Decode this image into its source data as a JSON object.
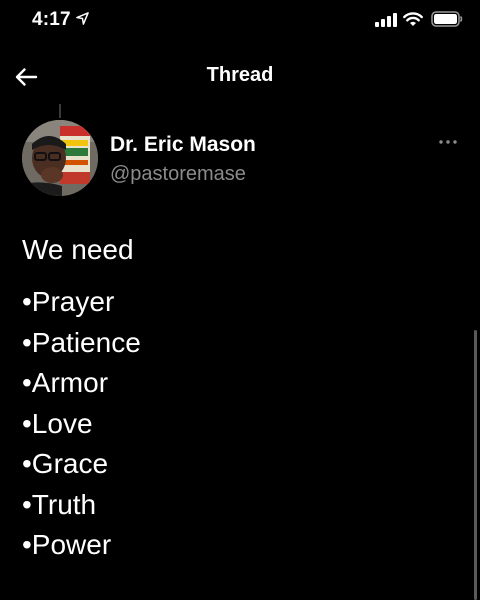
{
  "status_bar": {
    "time": "4:17",
    "icons": [
      "location-arrow-icon",
      "cellular-signal-icon",
      "wifi-icon",
      "battery-icon"
    ]
  },
  "header": {
    "title": "Thread",
    "back_icon": "back-arrow-icon"
  },
  "tweet": {
    "author_name": "Dr. Eric Mason",
    "author_handle": "@pastoremase",
    "intro": "We need",
    "items": [
      "•Prayer",
      "•Patience",
      "•Armor",
      "•Love",
      "•Grace",
      "•Truth",
      "•Power"
    ],
    "more_icon": "more-options-icon"
  },
  "colors": {
    "background": "#000000",
    "primary_text": "#ffffff",
    "secondary_text": "#8b8b8b"
  }
}
